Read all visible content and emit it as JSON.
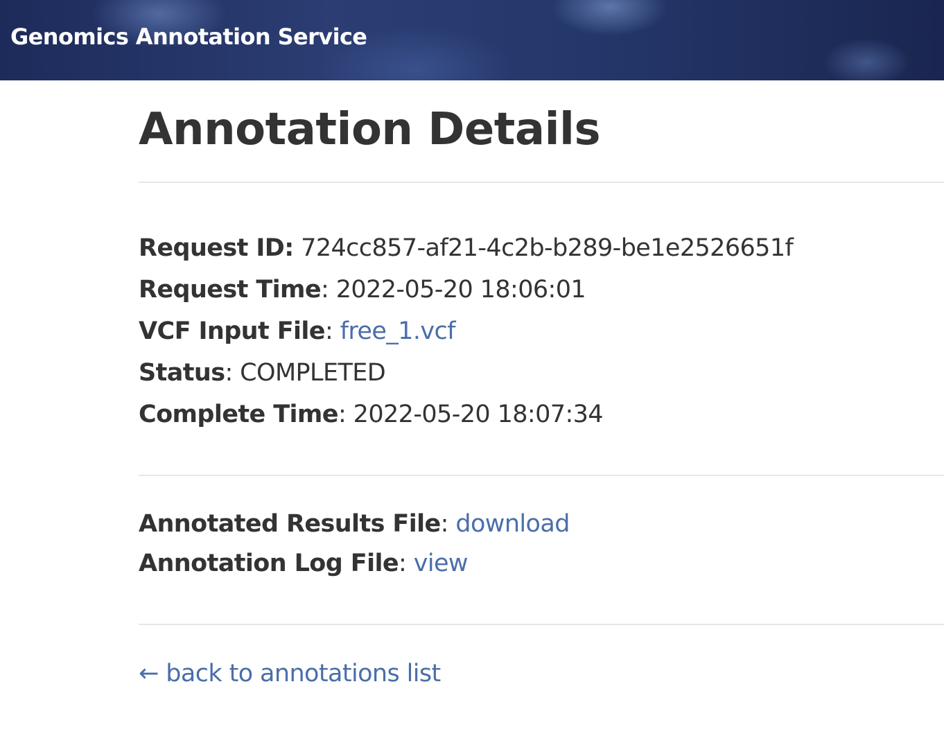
{
  "header": {
    "brand": "Genomics Annotation Service"
  },
  "page": {
    "title": "Annotation Details"
  },
  "details": {
    "request_id_label": "Request ID:",
    "request_id_value": "724cc857-af21-4c2b-b289-be1e2526651f",
    "request_time_label": "Request Time",
    "request_time_value": "2022-05-20 18:06:01",
    "input_file_label": "VCF Input File",
    "input_file_link": "free_1.vcf",
    "status_label": "Status",
    "status_value": "COMPLETED",
    "complete_time_label": "Complete Time",
    "complete_time_value": "2022-05-20 18:07:34"
  },
  "files": {
    "results_label": "Annotated Results File",
    "results_link": "download",
    "log_label": "Annotation Log File",
    "log_link": "view"
  },
  "nav": {
    "back_arrow": "←",
    "back_label": "back to annotations list"
  },
  "colors": {
    "link": "#4a6ea8",
    "text": "#333333",
    "banner": "#25386c"
  }
}
